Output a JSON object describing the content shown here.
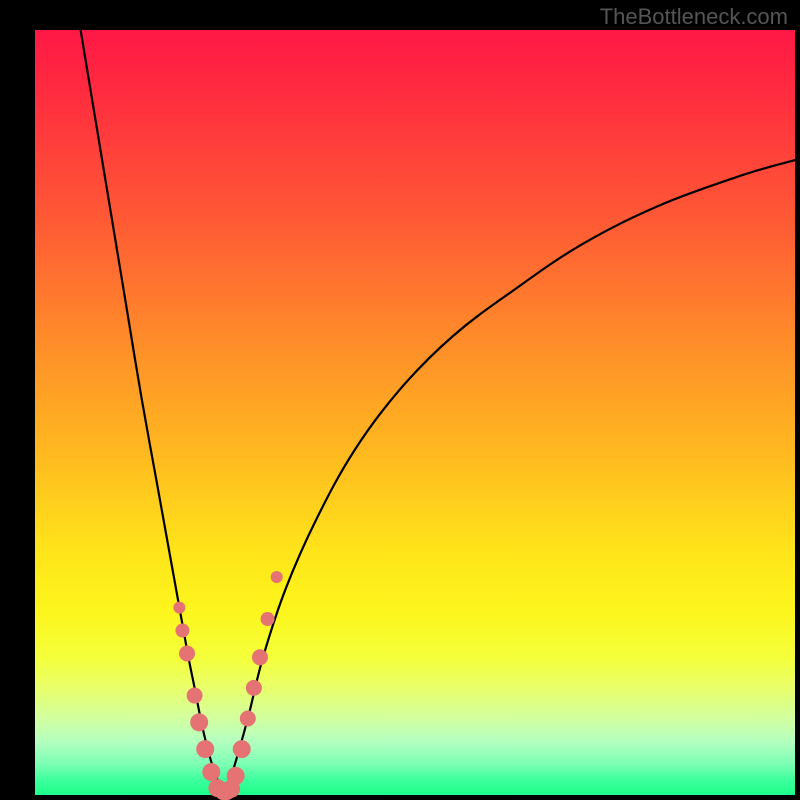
{
  "watermark": "TheBottleneck.com",
  "chart_data": {
    "type": "line",
    "title": "",
    "xlabel": "",
    "ylabel": "",
    "xlim": [
      0,
      100
    ],
    "ylim": [
      0,
      100
    ],
    "grid": false,
    "series": [
      {
        "name": "left-branch",
        "x": [
          6,
          8,
          10,
          12,
          14,
          16,
          18,
          20,
          21,
          22,
          23,
          24,
          25
        ],
        "y": [
          100,
          88,
          76,
          64,
          52,
          41,
          30,
          19,
          14,
          9,
          5,
          2,
          0
        ]
      },
      {
        "name": "right-branch",
        "x": [
          25,
          26,
          28,
          30,
          33,
          37,
          42,
          48,
          55,
          63,
          72,
          82,
          93,
          100
        ],
        "y": [
          0,
          3,
          10,
          18,
          27,
          36,
          45,
          53,
          60,
          66,
          72,
          77,
          81,
          83
        ]
      }
    ],
    "scatter_points": {
      "name": "dots",
      "x": [
        19.0,
        19.4,
        20.0,
        21.0,
        21.6,
        22.4,
        23.2,
        24.0,
        24.8,
        25.2,
        25.8,
        26.4,
        27.2,
        28.0,
        28.8,
        29.6,
        30.6,
        31.8
      ],
      "y": [
        24.5,
        21.5,
        18.5,
        13.0,
        9.5,
        6.0,
        3.0,
        0.9,
        0.5,
        0.5,
        0.8,
        2.5,
        6.0,
        10.0,
        14.0,
        18.0,
        23.0,
        28.5
      ],
      "r": [
        6,
        7,
        8,
        8,
        9,
        9,
        9,
        9,
        9,
        9,
        9,
        9,
        9,
        8,
        8,
        8,
        7,
        6
      ]
    },
    "background_gradient": {
      "top": "#ff1846",
      "upper_mid": "#ff8a2a",
      "mid": "#ffe41a",
      "lower": "#3dff9e"
    }
  }
}
